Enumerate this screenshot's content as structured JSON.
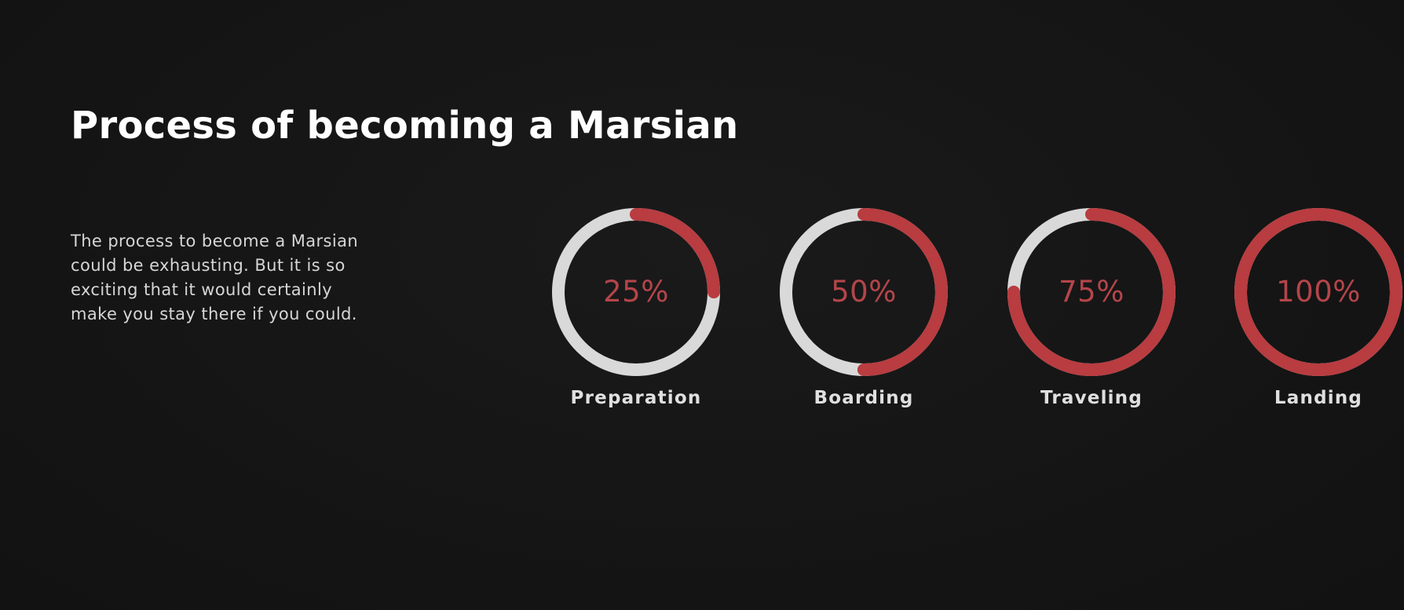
{
  "title": "Process of becoming a Marsian",
  "description": "The process to become a Marsian could be exhausting. But it is so exciting that it would certainly make you stay there if you could.",
  "colors": {
    "progress": "#b83c40",
    "track": "#d9d9d9",
    "percent_text": "#b4454a",
    "background": "#151515"
  },
  "stages": [
    {
      "label": "Preparation",
      "percent_text": "25%",
      "progress": 0.25
    },
    {
      "label": "Boarding",
      "percent_text": "50%",
      "progress": 0.5
    },
    {
      "label": "Traveling",
      "percent_text": "75%",
      "progress": 0.75
    },
    {
      "label": "Landing",
      "percent_text": "100%",
      "progress": 1.0
    }
  ]
}
